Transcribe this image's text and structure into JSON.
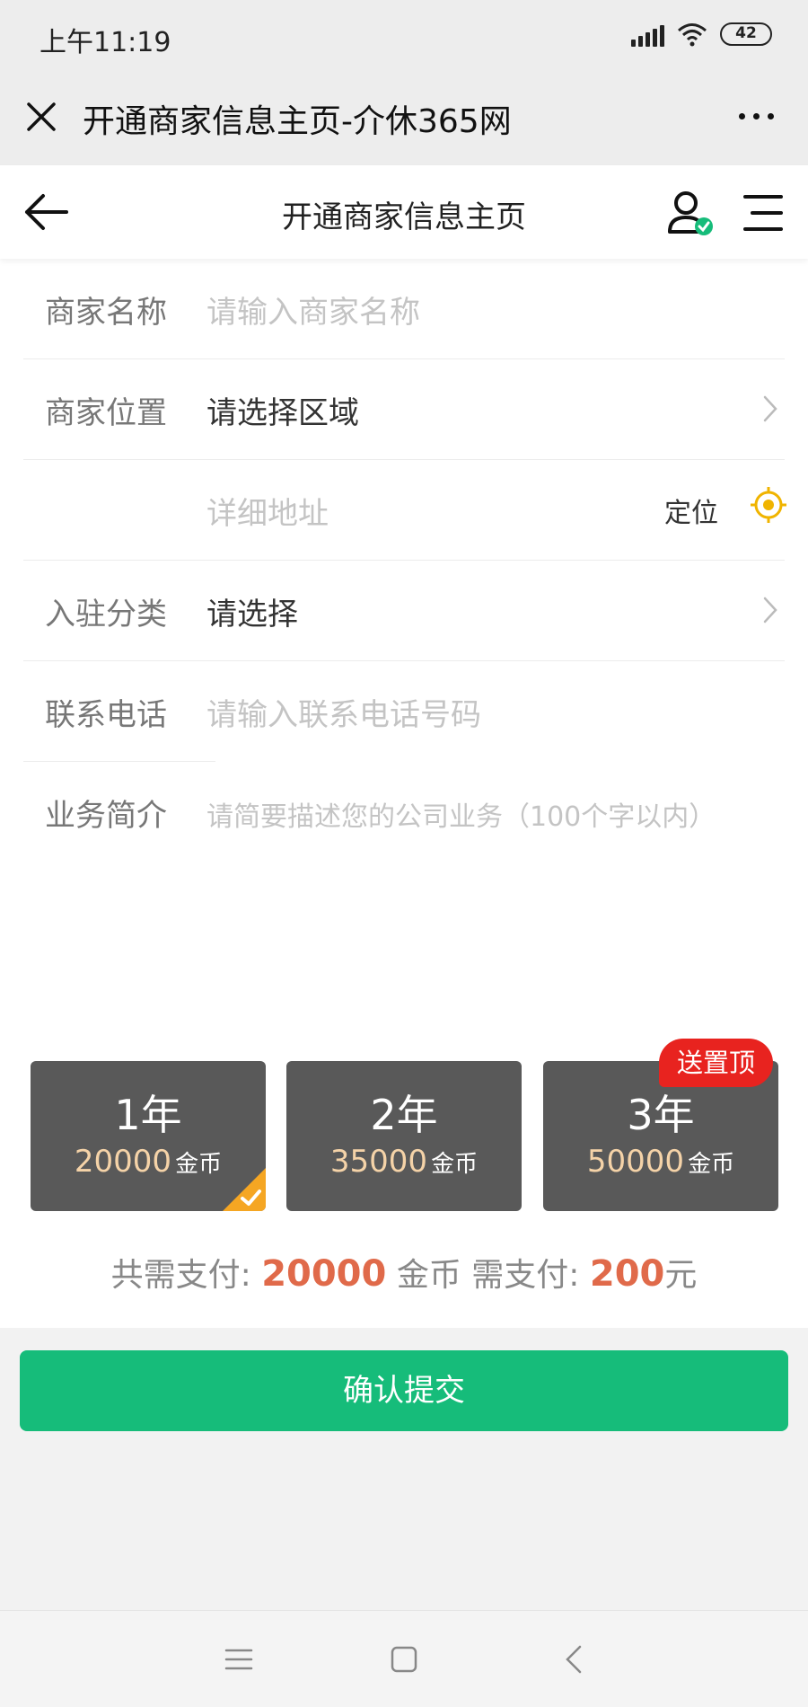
{
  "status_bar": {
    "time": "上午11:19",
    "battery": "42"
  },
  "wechat_bar": {
    "title": "开通商家信息主页-介休365网"
  },
  "nav": {
    "title": "开通商家信息主页"
  },
  "form": {
    "merchant_name": {
      "label": "商家名称",
      "placeholder": "请输入商家名称"
    },
    "merchant_location": {
      "label": "商家位置",
      "value": "请选择区域"
    },
    "detail_address": {
      "placeholder": "详细地址",
      "locate_label": "定位"
    },
    "category": {
      "label": "入驻分类",
      "value": "请选择"
    },
    "phone": {
      "label": "联系电话",
      "placeholder": "请输入联系电话号码"
    },
    "intro": {
      "label": "业务简介",
      "placeholder": "请简要描述您的公司业务（100个字以内）"
    }
  },
  "plans": [
    {
      "years": "1年",
      "price": "20000",
      "unit": "金币",
      "selected": true
    },
    {
      "years": "2年",
      "price": "35000",
      "unit": "金币",
      "selected": false
    },
    {
      "years": "3年",
      "price": "50000",
      "unit": "金币",
      "selected": false,
      "badge": "送置顶"
    }
  ],
  "total": {
    "prefix": "共需支付:",
    "coins": "20000",
    "coin_unit": "金币",
    "pay_label": "需支付:",
    "amount": "200",
    "currency": "元"
  },
  "submit_label": "确认提交",
  "colors": {
    "accent_green": "#16bc7a",
    "highlight_orange": "#e06a4a",
    "badge_red": "#e8231f",
    "check_orange": "#f5a623"
  }
}
